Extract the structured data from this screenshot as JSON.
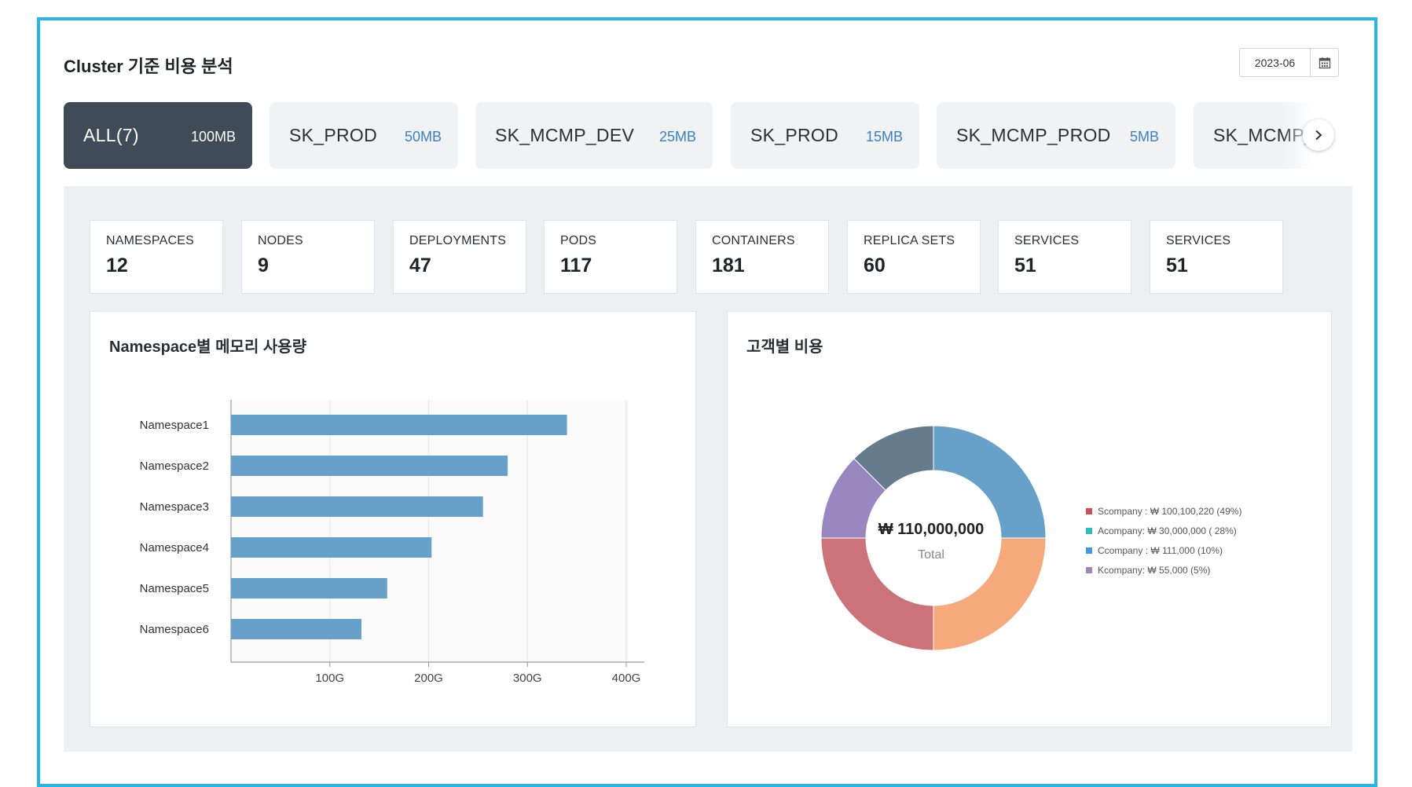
{
  "header": {
    "title": "Cluster 기준 비용 분석",
    "date": "2023-06"
  },
  "tabs": [
    {
      "label": "ALL(7)",
      "size": "100MB",
      "active": true
    },
    {
      "label": "SK_PROD",
      "size": "50MB"
    },
    {
      "label": "SK_MCMP_DEV",
      "size": "25MB"
    },
    {
      "label": "SK_PROD",
      "size": "15MB"
    },
    {
      "label": "SK_MCMP_PROD",
      "size": "5MB"
    },
    {
      "label": "SK_MCMP_PROD",
      "size": ""
    }
  ],
  "stats": [
    {
      "label": "NAMESPACES",
      "value": "12"
    },
    {
      "label": "NODES",
      "value": "9"
    },
    {
      "label": "DEPLOYMENTS",
      "value": "47"
    },
    {
      "label": "PODS",
      "value": "117"
    },
    {
      "label": "CONTAINERS",
      "value": "181"
    },
    {
      "label": "REPLICA SETS",
      "value": "60"
    },
    {
      "label": "SERVICES",
      "value": "51"
    },
    {
      "label": "SERVICES",
      "value": "51"
    }
  ],
  "bar_card": {
    "title": "Namespace별 메모리 사용량"
  },
  "donut_card": {
    "title": "고객별 비용",
    "center_value": "₩ 110,000,000",
    "center_label": "Total"
  },
  "colors": {
    "frame": "#27b3e6",
    "active_tab": "#3f4b57",
    "bar": "#67a0c9",
    "slices": [
      "#67a0c9",
      "#f6a97b",
      "#cc737a",
      "#9b87c0",
      "#667b8c"
    ],
    "legend": [
      "#cc4f5a",
      "#2bbdb8",
      "#3f9ae0",
      "#9b87c0"
    ]
  },
  "icons": {
    "calendar": "calendar-icon",
    "next": "chevron-right-icon"
  },
  "chart_data": [
    {
      "type": "bar",
      "orientation": "horizontal",
      "title": "Namespace별 메모리 사용량",
      "categories": [
        "Namespace1",
        "Namespace2",
        "Namespace3",
        "Namespace4",
        "Namespace5",
        "Namespace6"
      ],
      "values": [
        340,
        280,
        255,
        203,
        158,
        132
      ],
      "xticks": [
        "100G",
        "200G",
        "300G",
        "400G"
      ],
      "xlim": [
        0,
        400
      ],
      "unit": "G",
      "grid": true
    },
    {
      "type": "pie",
      "donut": true,
      "title": "고객별 비용",
      "slices": [
        25,
        25,
        25,
        12.5,
        12.5
      ],
      "legend": [
        "Scompany : ₩ 100,100,220 (49%)",
        "Acompany: ₩ 30,000,000 ( 28%)",
        "Ccompany : ₩ 111,000 (10%)",
        "Kcompany: ₩ 55,000 (5%)"
      ],
      "legend_position": "right"
    }
  ]
}
